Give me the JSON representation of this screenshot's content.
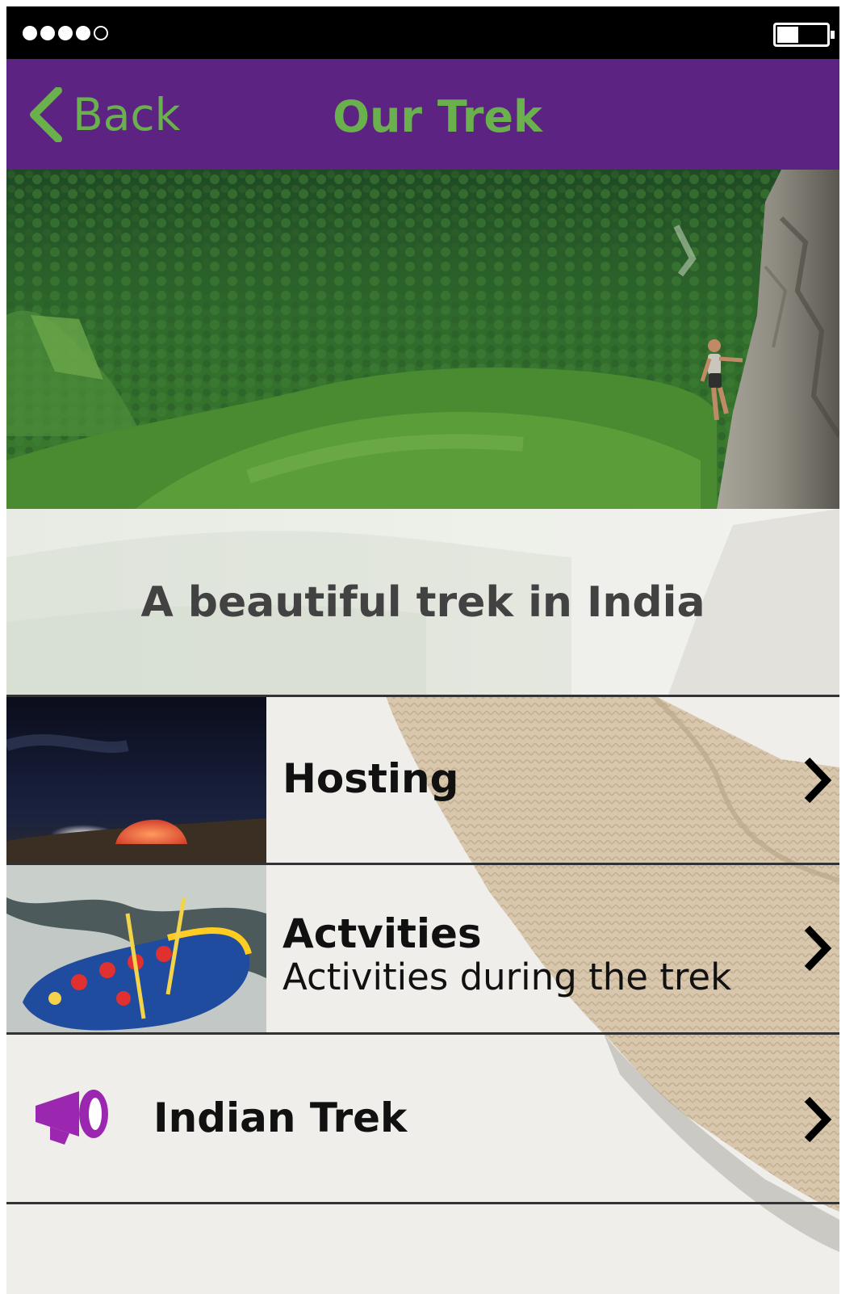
{
  "nav": {
    "back_label": "Back",
    "title": "Our Trek"
  },
  "hero": {
    "caption": "A beautiful trek in India"
  },
  "menu": {
    "items": [
      {
        "label": "Hosting",
        "subtitle": "",
        "icon": "tent-night-thumbnail"
      },
      {
        "label": "Actvities",
        "subtitle": "Activities during the trek",
        "icon": "rafting-thumbnail"
      },
      {
        "label": "Indian Trek",
        "subtitle": "",
        "icon": "megaphone-icon"
      }
    ]
  },
  "colors": {
    "navbar": "#5c2382",
    "accent_green": "#6ab04c",
    "megaphone": "#9b27b0"
  }
}
